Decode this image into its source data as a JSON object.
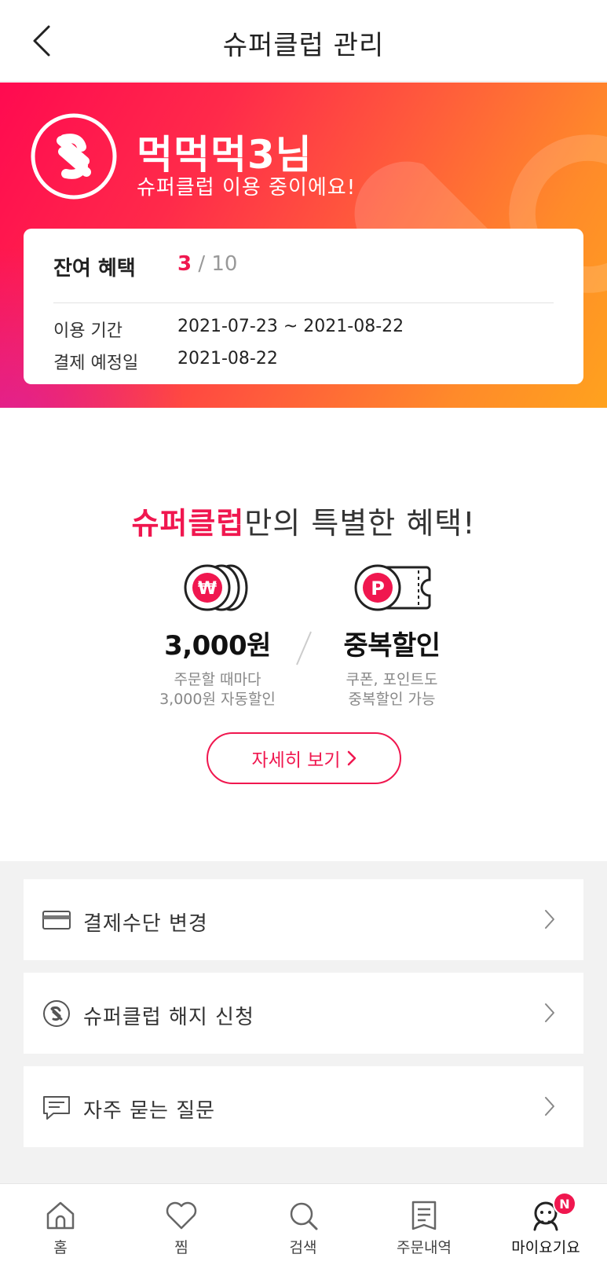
{
  "header": {
    "title": "슈퍼클럽 관리"
  },
  "hero": {
    "user_name": "먹먹먹3님",
    "status": "슈퍼클럽 이용 중이에요!",
    "card": {
      "remaining_label": "잔여 혜택",
      "remaining_current": "3",
      "remaining_total": "/ 10",
      "period_label": "이용 기간",
      "period_value": "2021-07-23 ~ 2021-08-22",
      "payment_label": "결제 예정일",
      "payment_value": "2021-08-22"
    }
  },
  "benefits": {
    "title_accent": "슈퍼클럽",
    "title_rest": "만의 특별한 혜택!",
    "items": [
      {
        "icon": "won-coins-icon",
        "main": "3,000원",
        "desc_line1": "주문할 때마다",
        "desc_line2": "3,000원 자동할인"
      },
      {
        "icon": "point-coupon-icon",
        "main": "중복할인",
        "desc_line1": "쿠폰, 포인트도",
        "desc_line2": "중복할인 가능"
      }
    ],
    "detail_button": "자세히 보기"
  },
  "menu": [
    {
      "icon": "credit-card-icon",
      "label": "결제수단 변경"
    },
    {
      "icon": "superclub-icon",
      "label": "슈퍼클럽 해지 신청"
    },
    {
      "icon": "chat-icon",
      "label": "자주 묻는 질문"
    }
  ],
  "bottom_nav": [
    {
      "icon": "home-icon",
      "label": "홈"
    },
    {
      "icon": "heart-icon",
      "label": "찜"
    },
    {
      "icon": "search-icon",
      "label": "검색"
    },
    {
      "icon": "order-list-icon",
      "label": "주문내역"
    },
    {
      "icon": "my-yogiyo-icon",
      "label": "마이요기요",
      "badge": "N"
    }
  ],
  "colors": {
    "accent": "#f0174f",
    "gradient_start": "#ff0a50",
    "gradient_end": "#ffa21e",
    "menu_bg": "#f2f2f2"
  }
}
